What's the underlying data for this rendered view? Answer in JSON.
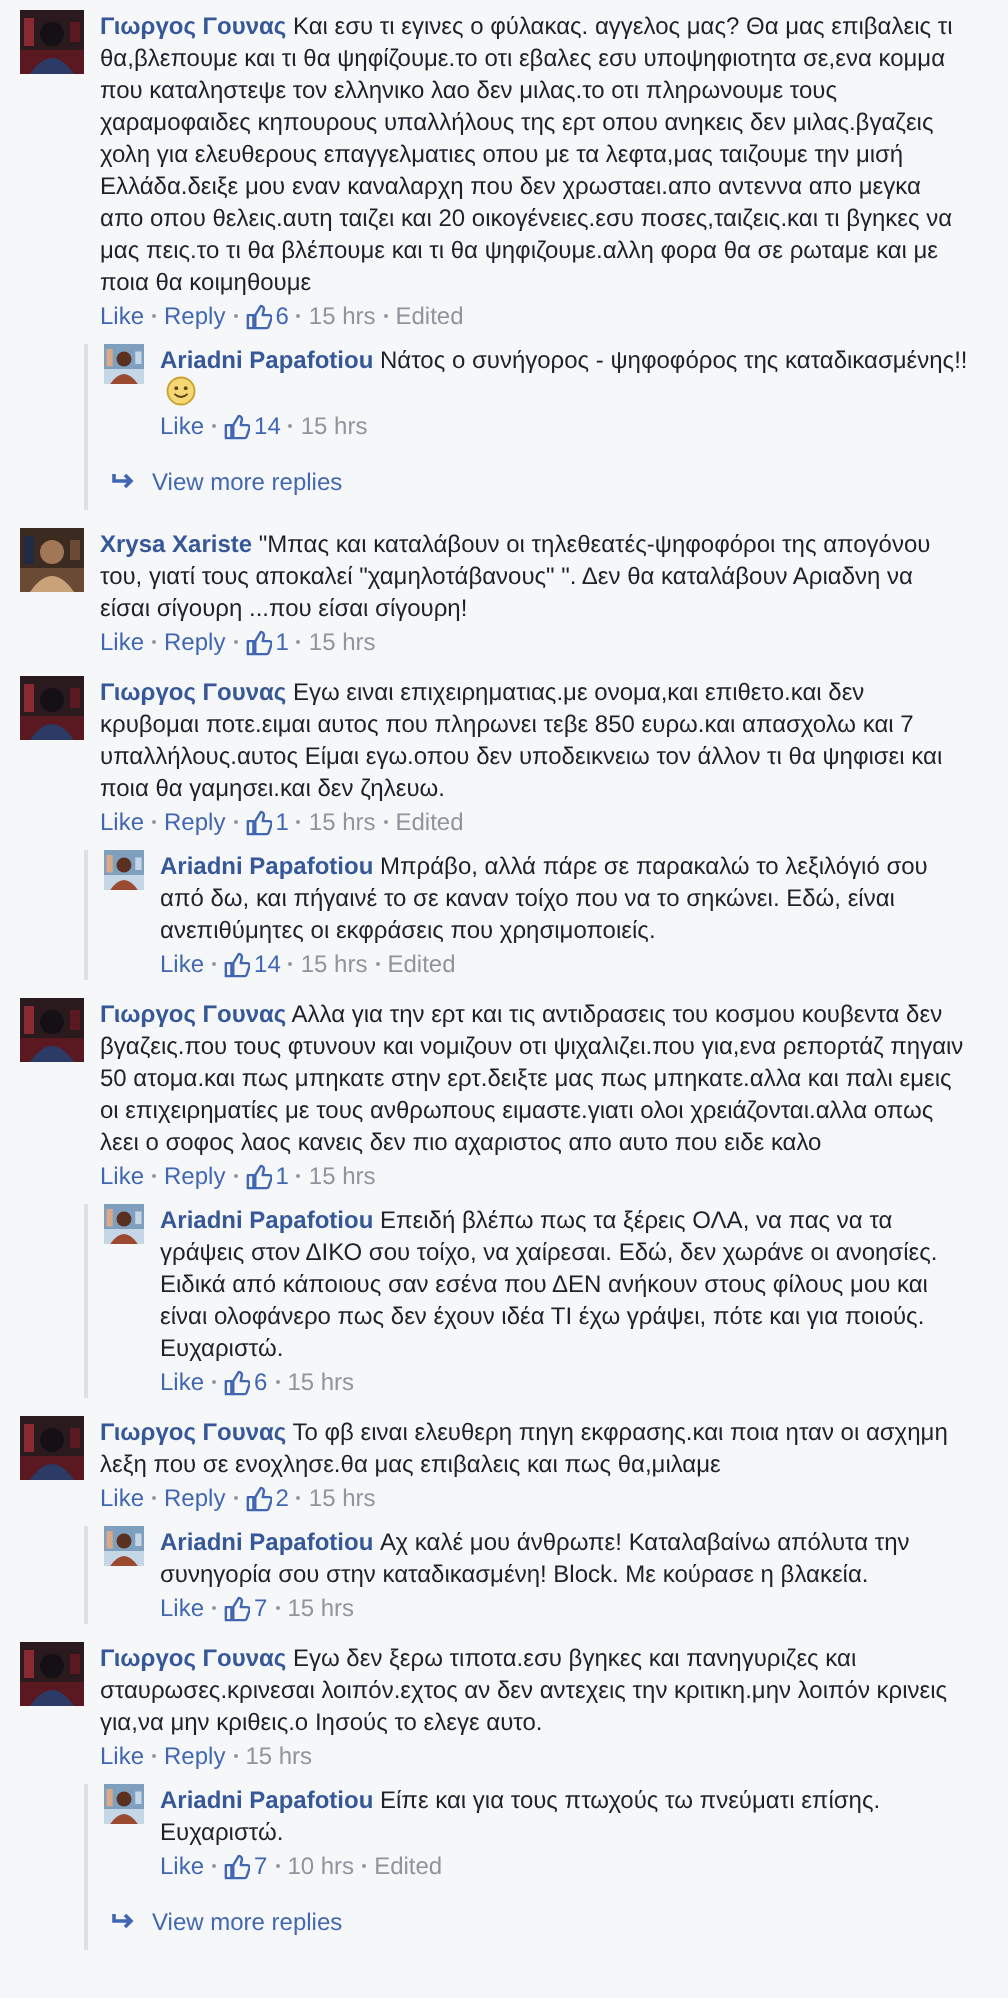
{
  "comments": [
    {
      "author": "Γιωργος Γουνας",
      "text": "Και εσυ τι εγινες ο φύλακας. αγγελος μας? Θα μας επιβαλεις τι θα,βλεπουμε και τι θα ψηφίζουμε.το οτι εβαλες εσυ υποψηφιοτητα σε,ενα κομμα που καταληστεψε τον ελληνικο λαο δεν μιλας.το οτι πληρωνουμε τους χαραμοφαιδες κηπουρους υπαλλήλους της ερτ οπου ανηκεις δεν μιλας.βγαζεις χολη για ελευθερους επαγγελματιες οπου με τα λεφτα,μας ταιζουμε την μισή Ελλάδα.δειξε μου εναν καναλαρχη που δεν χρωσταει.απο αντεννα απο μεγκα απο οπου θελεις.αυτη ταιζει και 20 οικογένειες.εσυ ποσες,ταιζεις.και τι βγηκες να μας πεις.το τι θα βλέπουμε και τι θα ψηφιζουμε.αλλη φορα θα σε ρωταμε και με ποια θα κοιμηθουμε",
      "like": "Like",
      "reply": "Reply",
      "likes": "6",
      "time": "15 hrs",
      "edited": "Edited",
      "replies": [
        {
          "author": "Ariadni Papafotiou",
          "text": "Νάτος ο συνήγορος - ψηφοφόρος της καταδικασμένης!!",
          "smiley": true,
          "like": "Like",
          "likes": "14",
          "time": "15 hrs"
        }
      ],
      "view_more": "View more replies"
    },
    {
      "author": "Xrysa Xariste",
      "text": "\"Μπας και καταλάβουν οι τηλεθεατές-ψηφοφόροι της απογόνου του, γιατί τους αποκαλεί \"χαμηλοτάβανους\" \". Δεν θα καταλάβουν Αριαδνη να είσαι σίγουρη ...που είσαι σίγουρη!",
      "like": "Like",
      "reply": "Reply",
      "likes": "1",
      "time": "15 hrs"
    },
    {
      "author": "Γιωργος Γουνας",
      "text": "Εγω ειναι επιχειρηματιας.με ονομα,και επιθετο.και δεν κρυβομαι ποτε.ειμαι αυτος που πληρωνει τεβε 850 ευρω.και απασχολω και 7 υπαλλήλους.αυτος Είμαι εγω.οπου δεν υποδεικνειω τον άλλον τι θα ψηφισει και ποια θα γαμησει.και δεν ζηλευω.",
      "like": "Like",
      "reply": "Reply",
      "likes": "1",
      "time": "15 hrs",
      "edited": "Edited",
      "replies": [
        {
          "author": "Ariadni Papafotiou",
          "text": "Μπράβο, αλλά πάρε σε παρακαλώ το λεξιλόγιό σου από δω, και πήγαινέ το σε καναν τοίχο που να το σηκώνει. Εδώ, είναι ανεπιθύμητες οι εκφράσεις που χρησιμοποιείς.",
          "like": "Like",
          "likes": "14",
          "time": "15 hrs",
          "edited": "Edited"
        }
      ]
    },
    {
      "author": "Γιωργος Γουνας",
      "text": "Αλλα για την ερτ και τις αντιδρασεις του κοσμου κουβεντα δεν βγαζεις.που τους φτυνουν και νομιζουν οτι ψιχαλιζει.που για,ενα ρεπορτάζ πηγαιν 50 ατομα.και πως μπηκατε στην ερτ.δειξτε μας πως μπηκατε.αλλα και παλι εμεις οι επιχειρηματίες με τους ανθρωπους ειμαστε.γιατι ολοι χρειάζονται.αλλα οπως λεει ο σοφος λαος κανεις δεν πιο αχαριστος απο αυτο που ειδε καλο",
      "like": "Like",
      "reply": "Reply",
      "likes": "1",
      "time": "15 hrs",
      "replies": [
        {
          "author": "Ariadni Papafotiou",
          "text": "Επειδή βλέπω πως τα ξέρεις ΟΛΑ, να πας να τα γράψεις στον ΔΙΚΟ σου τοίχο, να χαίρεσαι. Εδώ, δεν χωράνε οι ανοησίες. Ειδικά από κάποιους σαν εσένα που ΔΕΝ ανήκουν στους φίλους μου και είναι ολοφάνερο πως δεν έχουν ιδέα ΤΙ έχω γράψει, πότε και για ποιούς. Ευχαριστώ.",
          "like": "Like",
          "likes": "6",
          "time": "15 hrs"
        }
      ]
    },
    {
      "author": "Γιωργος Γουνας",
      "text": "Το φβ ειναι ελευθερη πηγη εκφρασης.και ποια ηταν οι ασχημη λεξη που σε ενοχλησε.θα μας επιβαλεις και πως θα,μιλαμε",
      "like": "Like",
      "reply": "Reply",
      "likes": "2",
      "time": "15 hrs",
      "replies": [
        {
          "author": "Ariadni Papafotiou",
          "text": "Αχ καλέ μου άνθρωπε! Καταλαβαίνω απόλυτα την συνηγορία σου στην καταδικασμένη! Block. Με κούρασε η βλακεία.",
          "like": "Like",
          "likes": "7",
          "time": "15 hrs"
        }
      ]
    },
    {
      "author": "Γιωργος Γουνας",
      "text": "Εγω δεν ξερω τιποτα.εσυ βγηκες και πανηγυριζες και σταυρωσες.κρινεσαι λοιπόν.εχτος αν δεν αντεχεις την κριτικη.μην λοιπόν κρινεις για,να μην κριθεις.ο Ιησούς το ελεγε αυτο.",
      "like": "Like",
      "reply": "Reply",
      "time": "15 hrs",
      "replies": [
        {
          "author": "Ariadni Papafotiou",
          "text": "Είπε και για τους πτωχούς τω πνεύματι επίσης. Ευχαριστώ.",
          "like": "Like",
          "likes": "7",
          "time": "10 hrs",
          "edited": "Edited"
        }
      ],
      "view_more": "View more replies"
    }
  ]
}
